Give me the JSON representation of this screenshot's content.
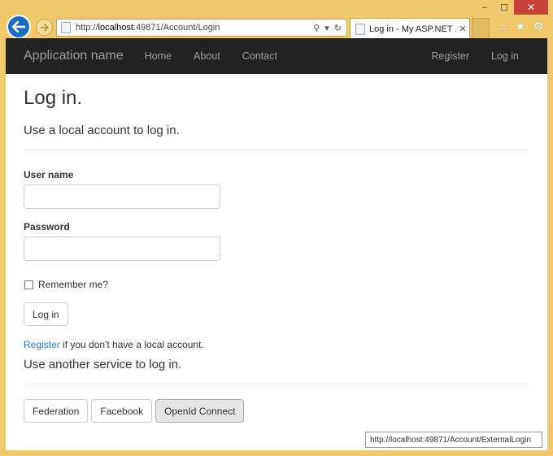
{
  "browser": {
    "window_controls": {
      "minimize": "–",
      "maximize": "☐",
      "close": "✕"
    },
    "address": {
      "url_prefix": "http://",
      "url_host": "localhost",
      "url_rest": ":49871/Account/Login",
      "search_glyph": "⚲",
      "dropdown_glyph": "▾",
      "refresh_glyph": "↻"
    },
    "tab": {
      "title": "Log in - My ASP.NET ...",
      "close": "✕"
    },
    "toolbar_icons": {
      "home": "⌂",
      "favorites": "★",
      "settings": "⚙"
    },
    "status_url": "http://localhost:49871/Account/ExternalLogin"
  },
  "navbar": {
    "brand": "Application name",
    "left_links": [
      "Home",
      "About",
      "Contact"
    ],
    "right_links": [
      "Register",
      "Log in"
    ]
  },
  "page": {
    "title": "Log in.",
    "subtitle": "Use a local account to log in.",
    "username_label": "User name",
    "username_value": "",
    "password_label": "Password",
    "password_value": "",
    "remember_label": "Remember me?",
    "login_button": "Log in",
    "register_link": "Register",
    "register_suffix": " if you don't have a local account.",
    "external_heading": "Use another service to log in.",
    "external_buttons": [
      "Federation",
      "Facebook",
      "OpenId Connect"
    ]
  },
  "colors": {
    "navbar_bg": "#222222",
    "link": "#2a7ab9",
    "chrome": "#f0c96d"
  }
}
